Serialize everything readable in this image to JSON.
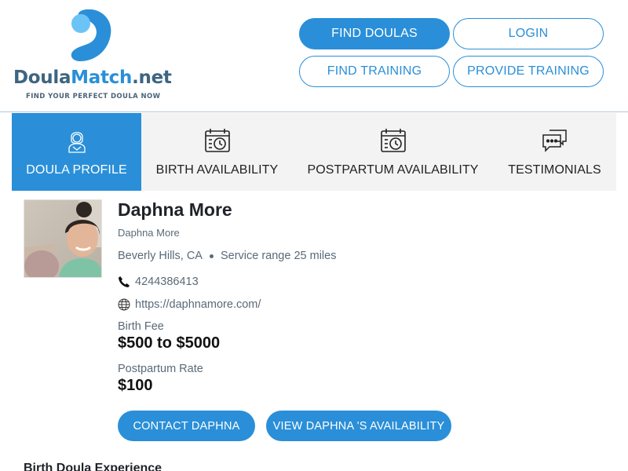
{
  "brand": {
    "name_part1": "Doula",
    "name_part2": "Match",
    "name_part3": ".net",
    "tagline": "FIND YOUR PERFECT DOULA NOW",
    "colors": {
      "primary": "#2a8fd8",
      "dark": "#3e6580"
    }
  },
  "nav": {
    "find_doulas": "FIND DOULAS",
    "login": "LOGIN",
    "find_training": "FIND TRAINING",
    "provide_training": "PROVIDE TRAINING"
  },
  "tabs": [
    {
      "label": "DOULA PROFILE",
      "icon": "doula-person-icon",
      "active": true
    },
    {
      "label": "BIRTH AVAILABILITY",
      "icon": "calendar-clock-icon",
      "active": false
    },
    {
      "label": "POSTPARTUM AVAILABILITY",
      "icon": "calendar-clock-icon",
      "active": false
    },
    {
      "label": "TESTIMONIALS",
      "icon": "chat-bubbles-icon",
      "active": false
    }
  ],
  "profile": {
    "name": "Daphna More",
    "subname": "Daphna More",
    "city": "Beverly Hills, CA",
    "service_range": "Service range 25 miles",
    "phone": "4244386413",
    "website": "https://daphnamore.com/",
    "birth_fee_label": "Birth Fee",
    "birth_fee": "$500 to $5000",
    "postpartum_label": "Postpartum Rate",
    "postpartum_rate": "$100"
  },
  "actions": {
    "contact": "CONTACT DAPHNA",
    "availability": "VIEW DAPHNA 'S AVAILABILITY"
  },
  "sections": {
    "birth_experience": "Birth Doula Experience"
  }
}
